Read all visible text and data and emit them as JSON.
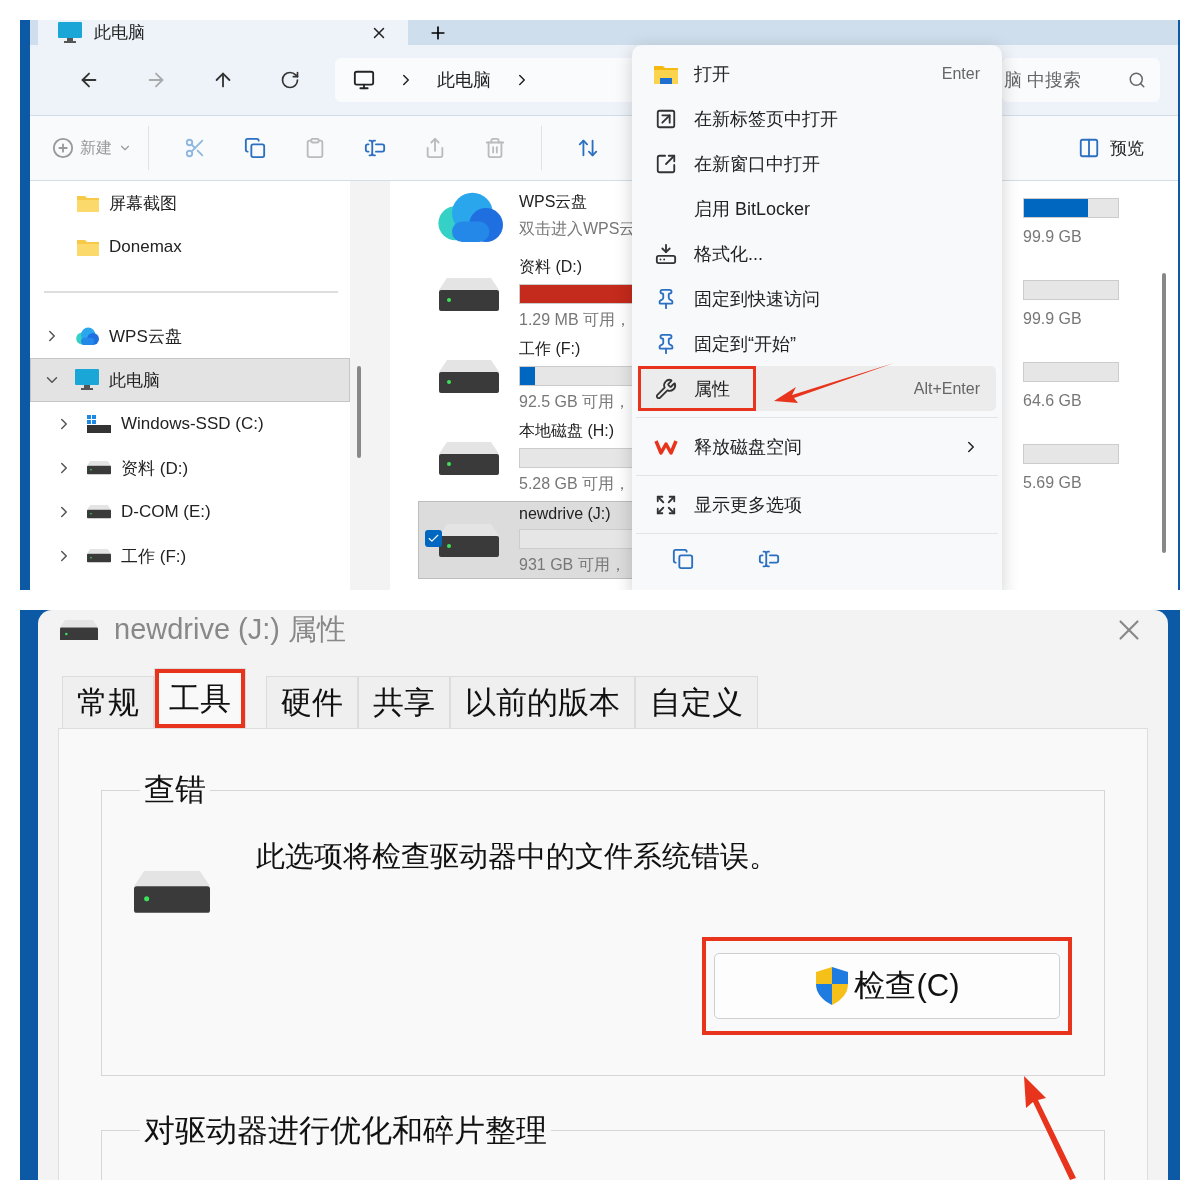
{
  "explorer": {
    "tab": {
      "title": "此电脑"
    },
    "address": {
      "crumbs": [
        "此电脑"
      ]
    },
    "search": {
      "placeholder": "脑 中搜索"
    },
    "toolbar": {
      "new_label": "新建",
      "preview_label": "预览"
    },
    "nav": [
      {
        "kind": "folder",
        "label": "屏幕截图",
        "selected": false
      },
      {
        "kind": "folder",
        "label": "Donemax",
        "selected": false
      },
      {
        "kind": "divider"
      },
      {
        "kind": "cloud",
        "label": "WPS云盘",
        "selected": false,
        "expanded": false
      },
      {
        "kind": "pc",
        "label": "此电脑",
        "selected": true,
        "expanded": true,
        "children": [
          {
            "kind": "system-drive",
            "label": "Windows-SSD (C:)",
            "selected": false,
            "expanded": false
          },
          {
            "kind": "drive",
            "label": "资料 (D:)",
            "selected": false,
            "expanded": false
          },
          {
            "kind": "drive",
            "label": "D-COM (E:)",
            "selected": false,
            "expanded": false
          },
          {
            "kind": "drive",
            "label": "工作 (F:)",
            "selected": false,
            "expanded": false
          }
        ]
      }
    ],
    "drives": [
      {
        "kind": "cloud",
        "name": "WPS云盘",
        "detail": "双击进入WPS云",
        "selected": false
      },
      {
        "kind": "drive",
        "name": "资料 (D:)",
        "detail": "1.29 MB 可用，",
        "level": 1,
        "low_space": true,
        "selected": false
      },
      {
        "kind": "drive",
        "name": "工作 (F:)",
        "detail": "92.5 GB 可用，",
        "level": 0.11,
        "low_space": false,
        "selected": false
      },
      {
        "kind": "drive",
        "name": "本地磁盘 (H:)",
        "detail": "5.28 GB 可用，",
        "selected": false
      },
      {
        "kind": "drive",
        "name": "newdrive (J:)",
        "detail": "931 GB 可用，",
        "selected": true
      }
    ],
    "drives_right": [
      {
        "detail": "99.9 GB",
        "level": 0.68
      },
      {
        "detail": "99.9 GB"
      },
      {
        "detail": "64.6 GB"
      },
      {
        "detail": "5.69 GB"
      }
    ]
  },
  "context_menu": {
    "items": [
      {
        "kind": "item",
        "label": "打开",
        "shortcut": "Enter",
        "highlighted": false,
        "callout": false
      },
      {
        "kind": "item",
        "label": "在新标签页中打开",
        "highlighted": false,
        "callout": false
      },
      {
        "kind": "item",
        "label": "在新窗口中打开",
        "highlighted": false,
        "callout": false
      },
      {
        "kind": "item",
        "label": "启用 BitLocker",
        "highlighted": false,
        "callout": false
      },
      {
        "kind": "item",
        "label": "格式化...",
        "highlighted": false,
        "callout": false
      },
      {
        "kind": "item",
        "label": "固定到快速访问",
        "highlighted": false,
        "callout": false
      },
      {
        "kind": "item",
        "label": "固定到“开始”",
        "highlighted": false,
        "callout": false
      },
      {
        "kind": "item",
        "label": "属性",
        "shortcut": "Alt+Enter",
        "highlighted": true,
        "callout": true
      },
      {
        "kind": "separator"
      },
      {
        "kind": "submenu",
        "label": "释放磁盘空间",
        "highlighted": false,
        "callout": false
      },
      {
        "kind": "separator"
      },
      {
        "kind": "item",
        "label": "显示更多选项",
        "highlighted": false,
        "callout": false
      },
      {
        "kind": "separator"
      }
    ]
  },
  "dialog": {
    "title": "newdrive (J:) 属性",
    "tabs": [
      {
        "label": "常规",
        "selected": false,
        "callout": false
      },
      {
        "label": "工具",
        "selected": true,
        "callout": true
      },
      {
        "label": "硬件",
        "selected": false,
        "callout": false
      },
      {
        "label": "共享",
        "selected": false,
        "callout": false
      },
      {
        "label": "以前的版本",
        "selected": false,
        "callout": false
      },
      {
        "label": "自定义",
        "selected": false,
        "callout": false
      }
    ],
    "groups": [
      {
        "title": "查错",
        "text": "此选项将检查驱动器中的文件系统错误。",
        "button": {
          "label": "检查(C)",
          "callout": true
        }
      },
      {
        "title": "对驱动器进行优化和碎片整理"
      }
    ]
  }
}
